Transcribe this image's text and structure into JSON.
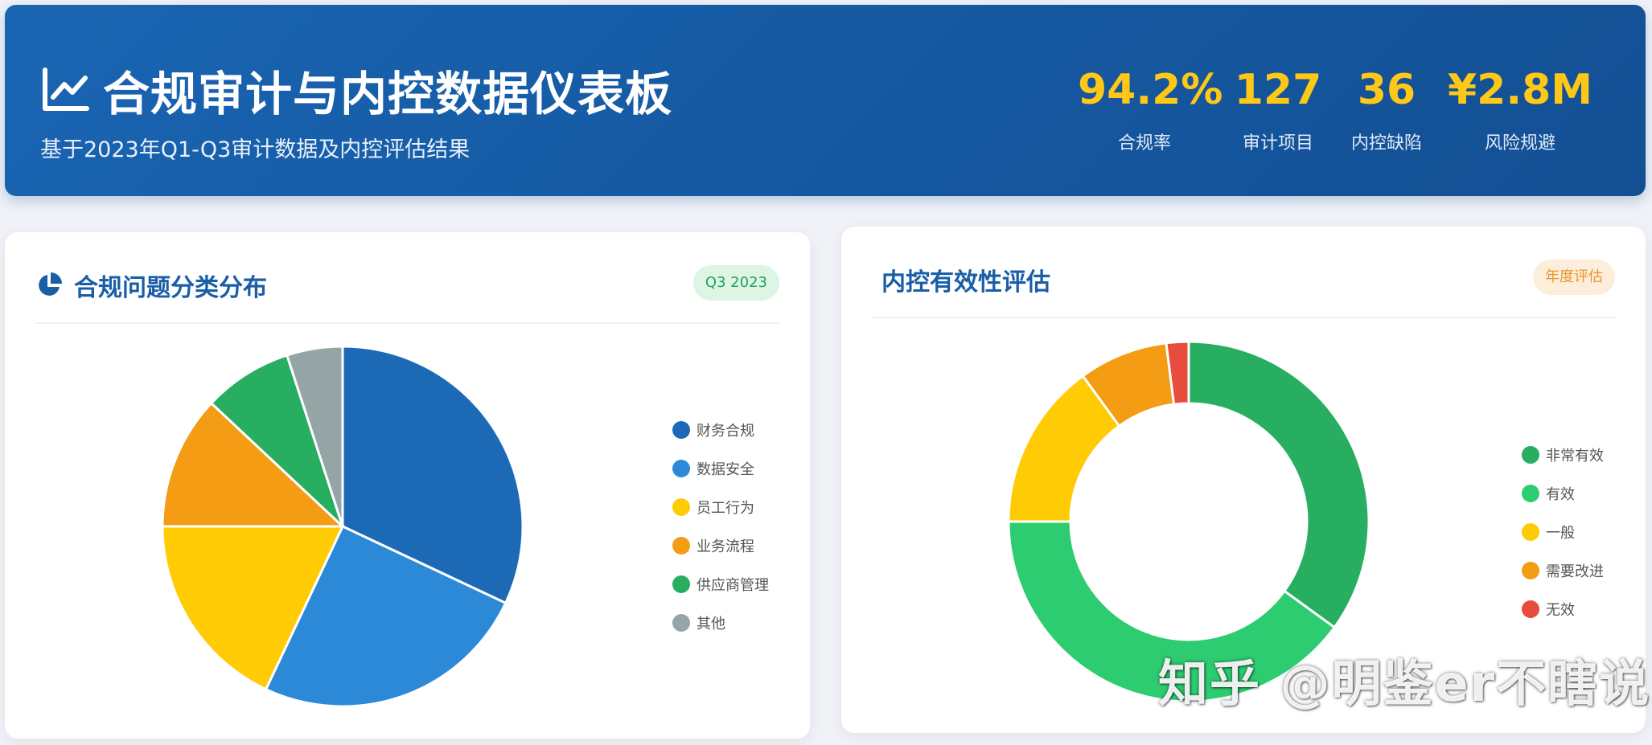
{
  "header": {
    "title": "合规审计与内控数据仪表板",
    "subtitle": "基于2023年Q1-Q3审计数据及内控评估结果",
    "kpis": [
      {
        "value": "94.2%",
        "label": "合规率"
      },
      {
        "value": "127",
        "label": "审计项目"
      },
      {
        "value": "36",
        "label": "内控缺陷"
      },
      {
        "value": "¥2.8M",
        "label": "风险规避"
      }
    ]
  },
  "panels": {
    "left": {
      "title": "合规问题分类分布",
      "badge": "Q3 2023"
    },
    "right": {
      "title": "内控有效性评估",
      "badge": "年度评估"
    }
  },
  "chart_data": [
    {
      "type": "pie",
      "title": "合规问题分类分布",
      "categories": [
        "财务合规",
        "数据安全",
        "员工行为",
        "业务流程",
        "供应商管理",
        "其他"
      ],
      "values": [
        32,
        25,
        18,
        12,
        8,
        5
      ],
      "colors": [
        "#1c6ab6",
        "#2c89d8",
        "#ffcb05",
        "#f39c14",
        "#27ae60",
        "#95a5a6"
      ],
      "legend": "right"
    },
    {
      "type": "pie",
      "title": "内控有效性评估",
      "categories": [
        "非常有效",
        "有效",
        "一般",
        "需要改进",
        "无效"
      ],
      "values": [
        35,
        40,
        15,
        8,
        2
      ],
      "colors": [
        "#27ae60",
        "#2ecc71",
        "#ffcb05",
        "#f39c14",
        "#e74c3c"
      ],
      "legend": "right"
    }
  ],
  "watermark": "知乎 @明鉴er不瞎说"
}
